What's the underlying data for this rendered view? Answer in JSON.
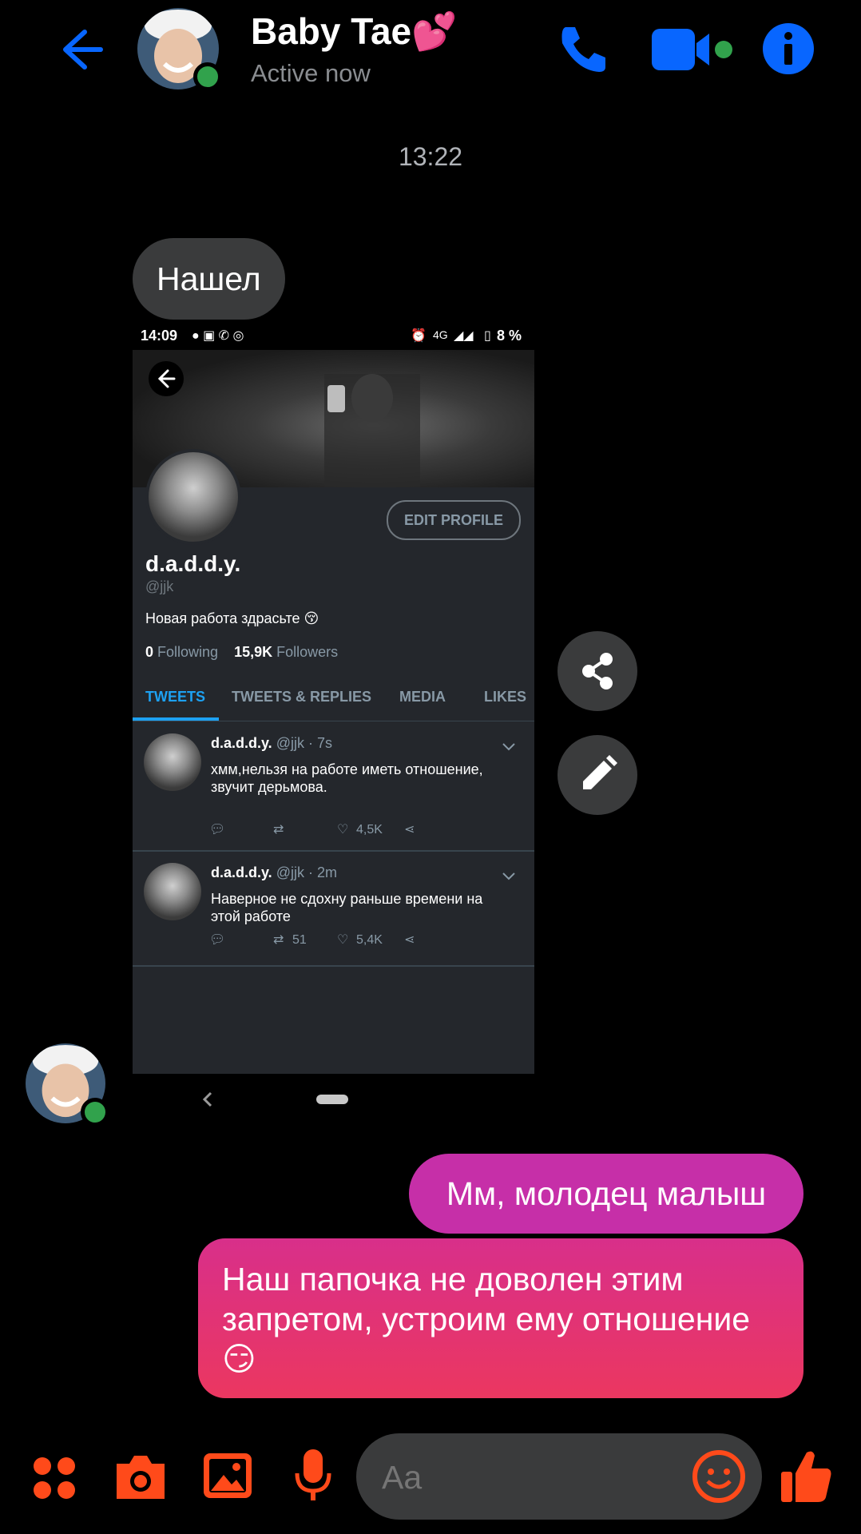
{
  "header": {
    "contact_name": "Baby Tae💕",
    "status": "Active now"
  },
  "conversation": {
    "time_separator": "13:22",
    "incoming_message": "Нашел",
    "outgoing_messages": [
      "Мм, молодец малыш",
      "Наш папочка не доволен этим запретом, устроим ему отношение😏"
    ]
  },
  "shared_screenshot": {
    "status_bar": {
      "time": "14:09",
      "network": "4G",
      "battery": "8 %"
    },
    "edit_profile": "EDIT PROFILE",
    "profile_name": "d.a.d.d.y.",
    "profile_handle": "@jjk",
    "bio": "Новая работа здрасьте 😚",
    "following_count": "0",
    "following_label": "Following",
    "followers_count": "15,9K",
    "followers_label": "Followers",
    "tabs": [
      "TWEETS",
      "TWEETS & REPLIES",
      "MEDIA",
      "LIKES"
    ],
    "tweets": [
      {
        "name": "d.a.d.d.y.",
        "meta": "@jjk · 7s",
        "text": "хмм,нельзя на работе иметь отношение, звучит дерьмова.",
        "retweets": "",
        "likes": "4,5K"
      },
      {
        "name": "d.a.d.d.y.",
        "meta": "@jjk · 2m",
        "text": "Наверное не сдохну раньше времени на этой работе",
        "retweets": "51",
        "likes": "5,4K"
      }
    ]
  },
  "composer": {
    "placeholder": "Aa"
  },
  "colors": {
    "accent_blue": "#0866ff",
    "accent_orange": "#ff4a1a",
    "online_green": "#31a24c",
    "outgoing_bubble_top": "#c62fa8",
    "outgoing_bubble_bottom": "#eb3760"
  }
}
